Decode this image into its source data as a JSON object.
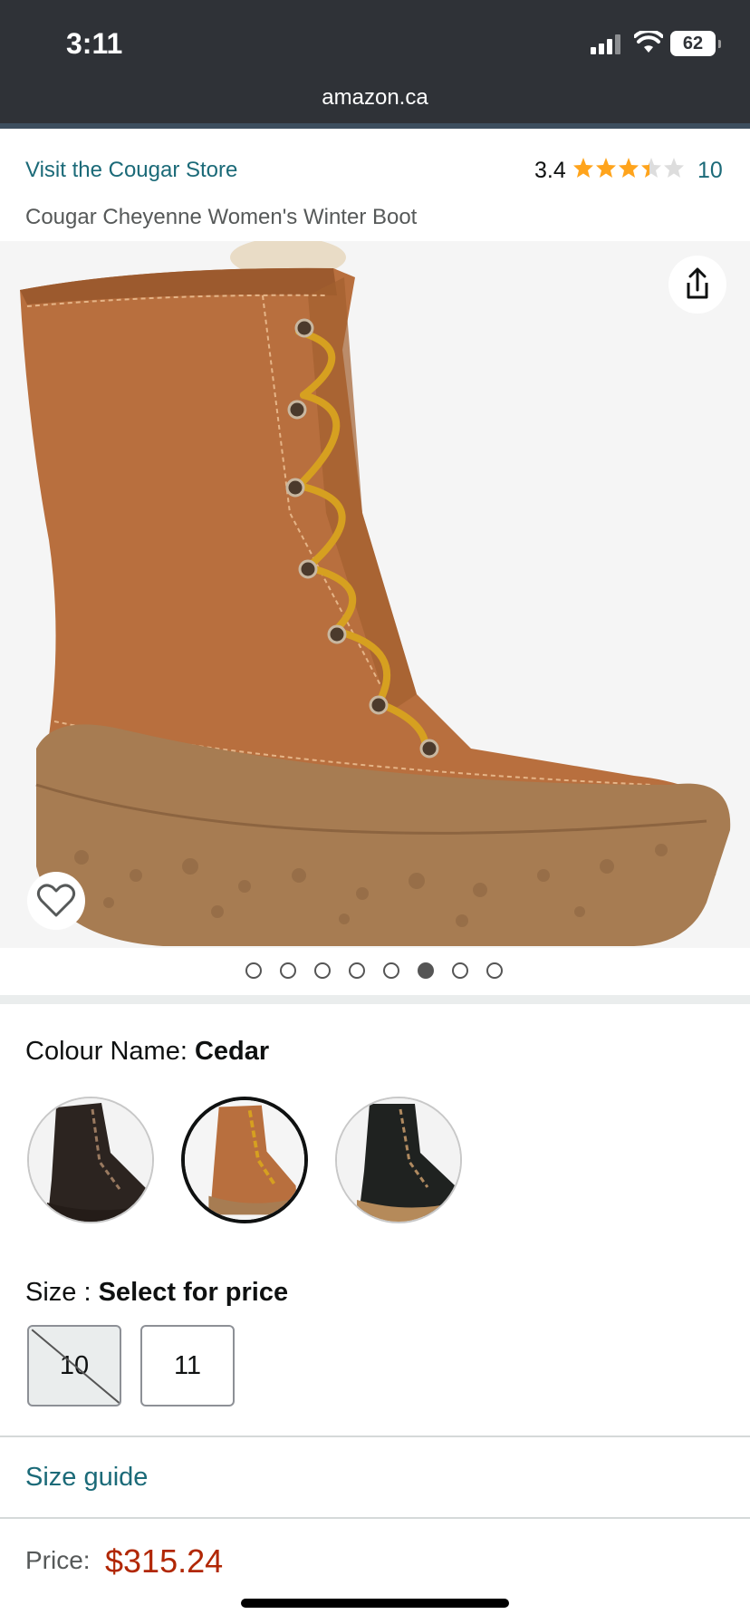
{
  "status_bar": {
    "time": "3:11",
    "battery": "62",
    "url": "amazon.ca"
  },
  "product": {
    "store_link": "Visit the Cougar Store",
    "rating": "3.4",
    "rating_stars_value": 3.4,
    "rating_count": "10",
    "title": "Cougar Cheyenne Women's Winter Boot"
  },
  "gallery": {
    "image_count": 8,
    "active_index": 5
  },
  "colour": {
    "label": "Colour Name: ",
    "selected": "Cedar",
    "swatches": [
      "black",
      "cedar",
      "black-tan"
    ]
  },
  "size": {
    "label": "Size : ",
    "selected": "Select for price",
    "options": [
      {
        "label": "10",
        "available": false
      },
      {
        "label": "11",
        "available": true
      }
    ]
  },
  "size_guide": "Size guide",
  "price": {
    "label": "Price:",
    "value": "$315.24"
  },
  "colors": {
    "link": "#1b6a78",
    "price": "#b12704",
    "star": "#ffa41c",
    "topbar": "#2f3237"
  }
}
